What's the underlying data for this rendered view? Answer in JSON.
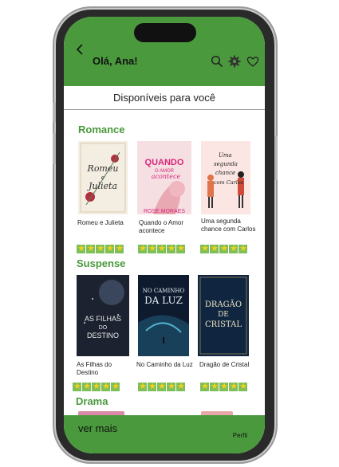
{
  "header": {
    "greeting": "Olá, Ana!"
  },
  "subheader": {
    "title": "Disponíveis para você"
  },
  "sections": [
    {
      "title": "Romance",
      "books": [
        {
          "title": "Romeu e Julieta",
          "cover_text": [
            "Romeu",
            "e",
            "Julieta"
          ],
          "rating": 5
        },
        {
          "title": "Quando o Amor acontece",
          "cover_text": [
            "QUANDO",
            "O AMOR",
            "acontece",
            "ROSE MORAES"
          ],
          "rating": 5
        },
        {
          "title": "Uma segunda chance com  Carlos",
          "cover_text": [
            "Uma",
            "segunda",
            "chance",
            "com Carlos"
          ],
          "rating": 5
        }
      ]
    },
    {
      "title": "Suspense",
      "books": [
        {
          "title": "As Filhas do Destino",
          "cover_text": [
            "AS FILHAS",
            "DO",
            "DESTINO"
          ],
          "rating": 5
        },
        {
          "title": "No Caminho da Luz",
          "cover_text": [
            "NO CAMINHO",
            "DA LUZ"
          ],
          "rating": 5
        },
        {
          "title": "Dragão de Cristal",
          "cover_text": [
            "DRAGÃO",
            "DE",
            "CRISTAL"
          ],
          "rating": 5
        }
      ]
    },
    {
      "title": "Drama",
      "books": []
    }
  ],
  "footer": {
    "more_label": "ver mais",
    "profile_label": "Perfil"
  },
  "icons": [
    "back-icon",
    "search-icon",
    "gear-icon",
    "heart-icon"
  ],
  "colors": {
    "brand": "#4a9a3d",
    "star": "#f4d01c"
  }
}
